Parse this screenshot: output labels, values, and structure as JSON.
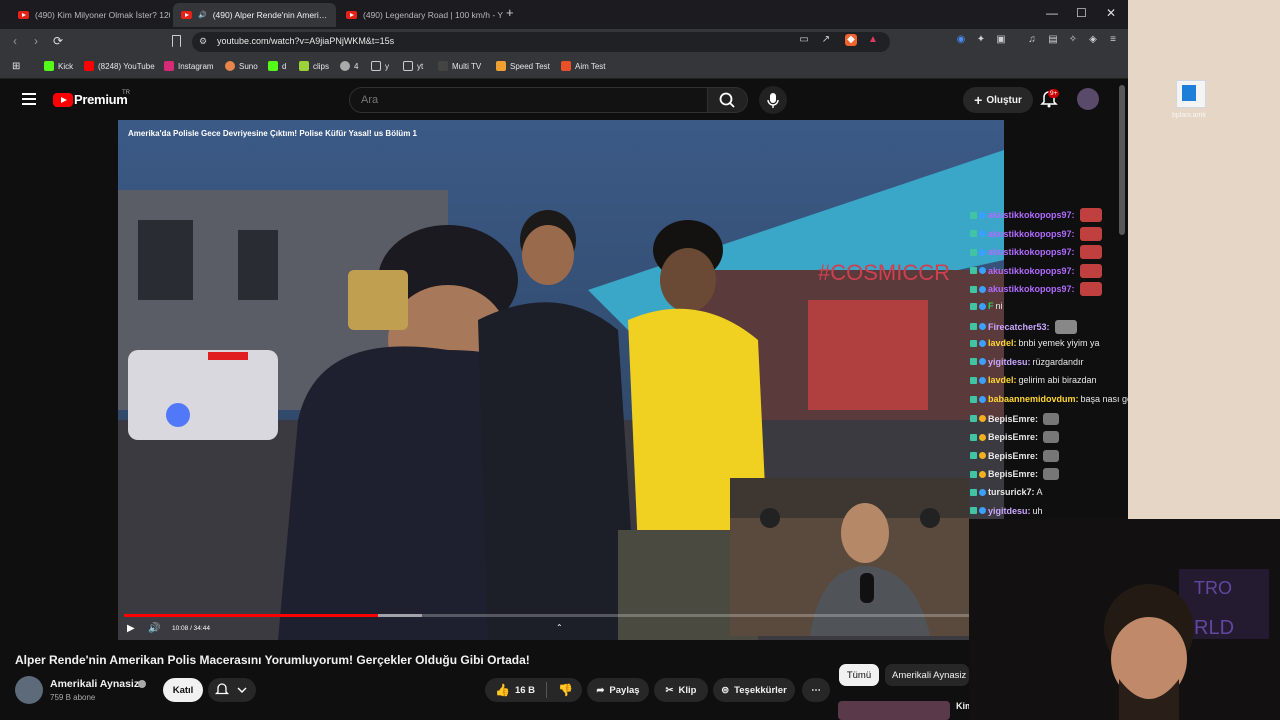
{
  "browser": {
    "tabs": [
      {
        "label": "(490) Kim Milyoner Olmak İster? 120…",
        "active": false
      },
      {
        "label": "(490) Alper Rende'nin Ameri…",
        "active": true
      },
      {
        "label": "(490) Legendary Road | 100 km/h - Y",
        "active": false
      }
    ],
    "new_tab": "+",
    "url": "youtube.com/watch?v=A9jiaPNjWKM&t=15s",
    "bookmarks": [
      "Kick",
      "(8248) YouTube",
      "Instagram",
      "Suno",
      "d",
      "clips",
      "4",
      "y",
      "yt",
      "Multi TV",
      "Speed Test",
      "Aim Test"
    ]
  },
  "youtube": {
    "brand": "Premium",
    "region": "TR",
    "search_placeholder": "Ara",
    "create_label": "Oluştur",
    "notif_badge": "9+"
  },
  "video": {
    "overlay_title": "Amerika'da Polisle Gece Devriyesine Çıktım! Polise Küfür Yasal! us Bölüm 1",
    "time": "10:08 / 34:44",
    "progress": 0.29,
    "buffered": 0.34
  },
  "chat": [
    {
      "user": "akustikkokopops97:",
      "msg": "",
      "color": "#b06bff",
      "emote": "#c04040"
    },
    {
      "user": "akustikkokopops97:",
      "msg": "",
      "color": "#b06bff",
      "emote": "#c04040"
    },
    {
      "user": "akustikkokopops97:",
      "msg": "",
      "color": "#b06bff",
      "emote": "#c04040"
    },
    {
      "user": "akustikkokopops97:",
      "msg": "",
      "color": "#b06bff",
      "emote": "#c04040"
    },
    {
      "user": "akustikkokopops97:",
      "msg": "",
      "color": "#b06bff",
      "emote": "#c04040"
    },
    {
      "user": "F",
      "msg": "ni",
      "color": "#2fd25a",
      "emote": ""
    },
    {
      "user": "Firecatcher53:",
      "msg": "",
      "color": "#c9a6ff",
      "emote": "#888888"
    },
    {
      "user": "lavdel:",
      "msg": "bnbi yemek yiyim ya",
      "color": "#ffd633",
      "emote": ""
    },
    {
      "user": "yigitdesu:",
      "msg": "rüzgardandır",
      "color": "#c9a6ff",
      "emote": ""
    },
    {
      "user": "lavdel:",
      "msg": "gelirim abi birazdan",
      "color": "#ffd633",
      "emote": ""
    },
    {
      "user": "babaannemidovdum:",
      "msg": "başa nası geri geldik",
      "color": "#ffd633",
      "emote": ""
    },
    {
      "user": "BepisEmre:",
      "msg": "",
      "color": "#e8e8e8",
      "emote": "#777777"
    },
    {
      "user": "BepisEmre:",
      "msg": "",
      "color": "#e8e8e8",
      "emote": "#777777"
    },
    {
      "user": "BepisEmre:",
      "msg": "",
      "color": "#e8e8e8",
      "emote": "#777777"
    },
    {
      "user": "BepisEmre:",
      "msg": "",
      "color": "#e8e8e8",
      "emote": "#777777"
    },
    {
      "user": "tursurick7:",
      "msg": "A",
      "color": "#e8e8e8",
      "emote": ""
    },
    {
      "user": "yigitdesu:",
      "msg": "uh",
      "color": "#c9a6ff",
      "emote": ""
    }
  ],
  "desktop": {
    "icon_label": "bplani.amk"
  },
  "watch": {
    "title": "Alper Rende'nin Amerikan Polis Macerasını Yorumluyorum! Gerçekler Olduğu Gibi Ortada!",
    "channel": "Amerikali Aynasiz",
    "subscribers": "759 B abone",
    "join": "Katıl",
    "likes": "16 B",
    "share": "Paylaş",
    "clip": "Klip",
    "thanks": "Teşekkürler",
    "more": "⋯",
    "chips": [
      "Tümü",
      "Amerikali Aynasiz"
    ],
    "rec_title": "Kim"
  }
}
